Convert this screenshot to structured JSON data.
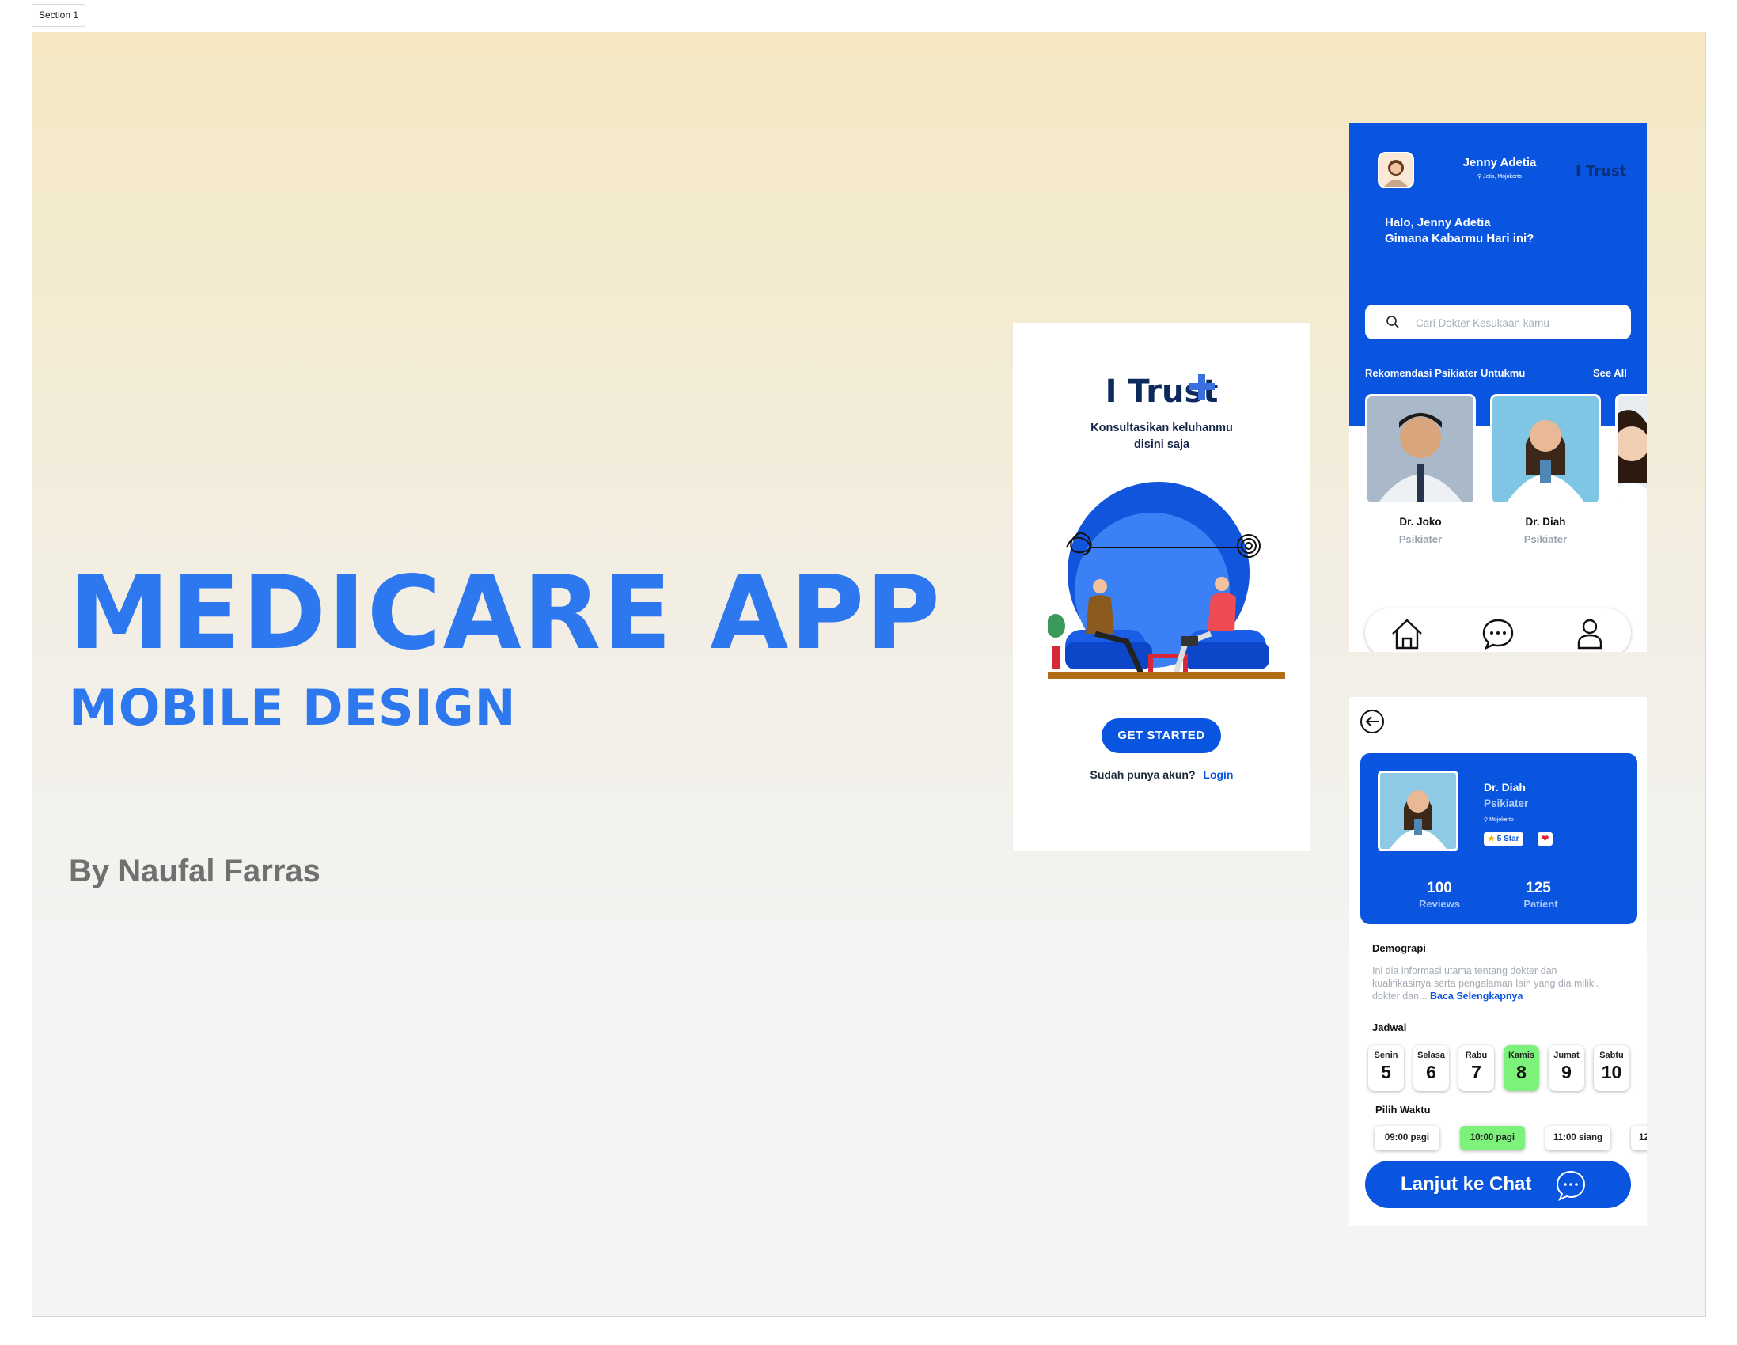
{
  "canvas": {
    "section_label": "Section 1"
  },
  "hero": {
    "title": "MEDICARE APP",
    "subtitle": "MOBILE DESIGN",
    "author": "By Naufal Farras"
  },
  "splash": {
    "logo": "I Trust",
    "tagline_1": "Konsultasikan keluhanmu",
    "tagline_2": "disini saja",
    "cta": "GET STARTED",
    "login_prompt": "Sudah punya akun?",
    "login_link": "Login"
  },
  "home": {
    "user_name": "Jenny Adetia",
    "user_location": "Jetis, Mojokerto",
    "brand": "I Trust",
    "greeting_1": "Halo, Jenny Adetia",
    "greeting_2": "Gimana Kabarmu Hari ini?",
    "search_placeholder": "Cari Dokter Kesukaan kamu",
    "recommend_title": "Rekomendasi Psikiater Untukmu",
    "see_all": "See All",
    "doctors": [
      {
        "name": "Dr. Joko",
        "role": "Psikiater"
      },
      {
        "name": "Dr. Diah",
        "role": "Psikiater"
      }
    ],
    "nav": [
      "home-icon",
      "chat-icon",
      "profile-icon"
    ]
  },
  "detail": {
    "doctor_name": "Dr. Diah",
    "doctor_role": "Psikiater",
    "doctor_location": "Mojokerto",
    "rating": "5 Star",
    "stats": [
      {
        "value": "100",
        "label": "Reviews"
      },
      {
        "value": "125",
        "label": "Patient"
      }
    ],
    "demographic_title": "Demograpi",
    "demographic_text": "Ini dia informasi utama tentang dokter dan kualifikasinya serta pengalaman lain yang dia miliki. dokter dan...",
    "read_more": "Baca Selengkapnya",
    "schedule_title": "Jadwal",
    "days": [
      {
        "name": "Senin",
        "num": "5"
      },
      {
        "name": "Selasa",
        "num": "6"
      },
      {
        "name": "Rabu",
        "num": "7"
      },
      {
        "name": "Kamis",
        "num": "8"
      },
      {
        "name": "Jumat",
        "num": "9"
      },
      {
        "name": "Sabtu",
        "num": "10"
      }
    ],
    "selected_day": "Kamis",
    "time_title": "Pilih Waktu",
    "times": [
      "09:00 pagi",
      "10:00 pagi",
      "11:00 siang",
      "12"
    ],
    "selected_time": "10:00 pagi",
    "chat_button": "Lanjut ke Chat"
  },
  "colors": {
    "primary": "#0a55e0",
    "hero_blue": "#2d78ef",
    "selected_green": "#7cf27a",
    "author_gray": "#707070"
  }
}
